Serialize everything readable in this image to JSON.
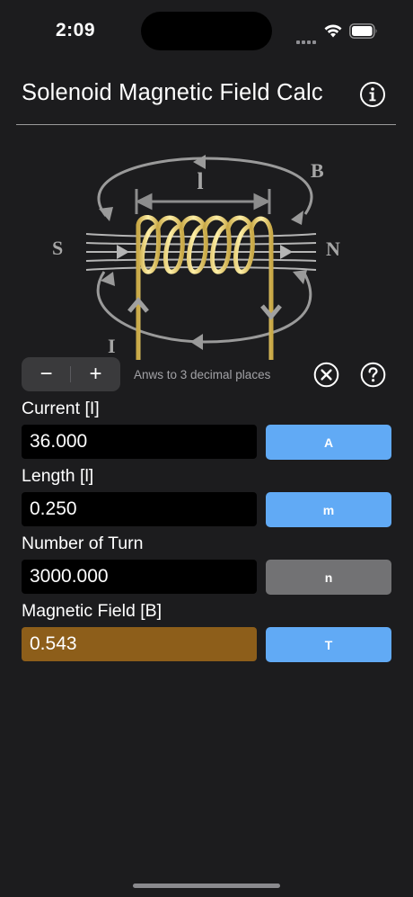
{
  "status_bar": {
    "time": "2:09"
  },
  "nav": {
    "title": "Solenoid Magnetic Field Calc",
    "info_icon": "info-circle-icon"
  },
  "diagram": {
    "label_length": "l",
    "label_field": "B",
    "label_south": "S",
    "label_north": "N",
    "label_current": "I"
  },
  "controls": {
    "minus_label": "−",
    "plus_label": "+",
    "precision_note": "Anws to 3 decimal places",
    "clear_icon": "clear-circle-icon",
    "help_icon": "question-circle-icon"
  },
  "fields": [
    {
      "label": "Current [I]",
      "value": "36.000",
      "unit": "A",
      "unit_color": "#61aaf5"
    },
    {
      "label": "Length [l]",
      "value": "0.250",
      "unit": "m",
      "unit_color": "#61aaf5"
    },
    {
      "label": "Number of Turn",
      "value": "3000.000",
      "unit": "n",
      "unit_color": "#727274"
    },
    {
      "label": "Magnetic Field [B]",
      "value": "0.543",
      "unit": "T",
      "unit_color": "#61aaf5",
      "value_background": "#8d5e1a"
    }
  ]
}
